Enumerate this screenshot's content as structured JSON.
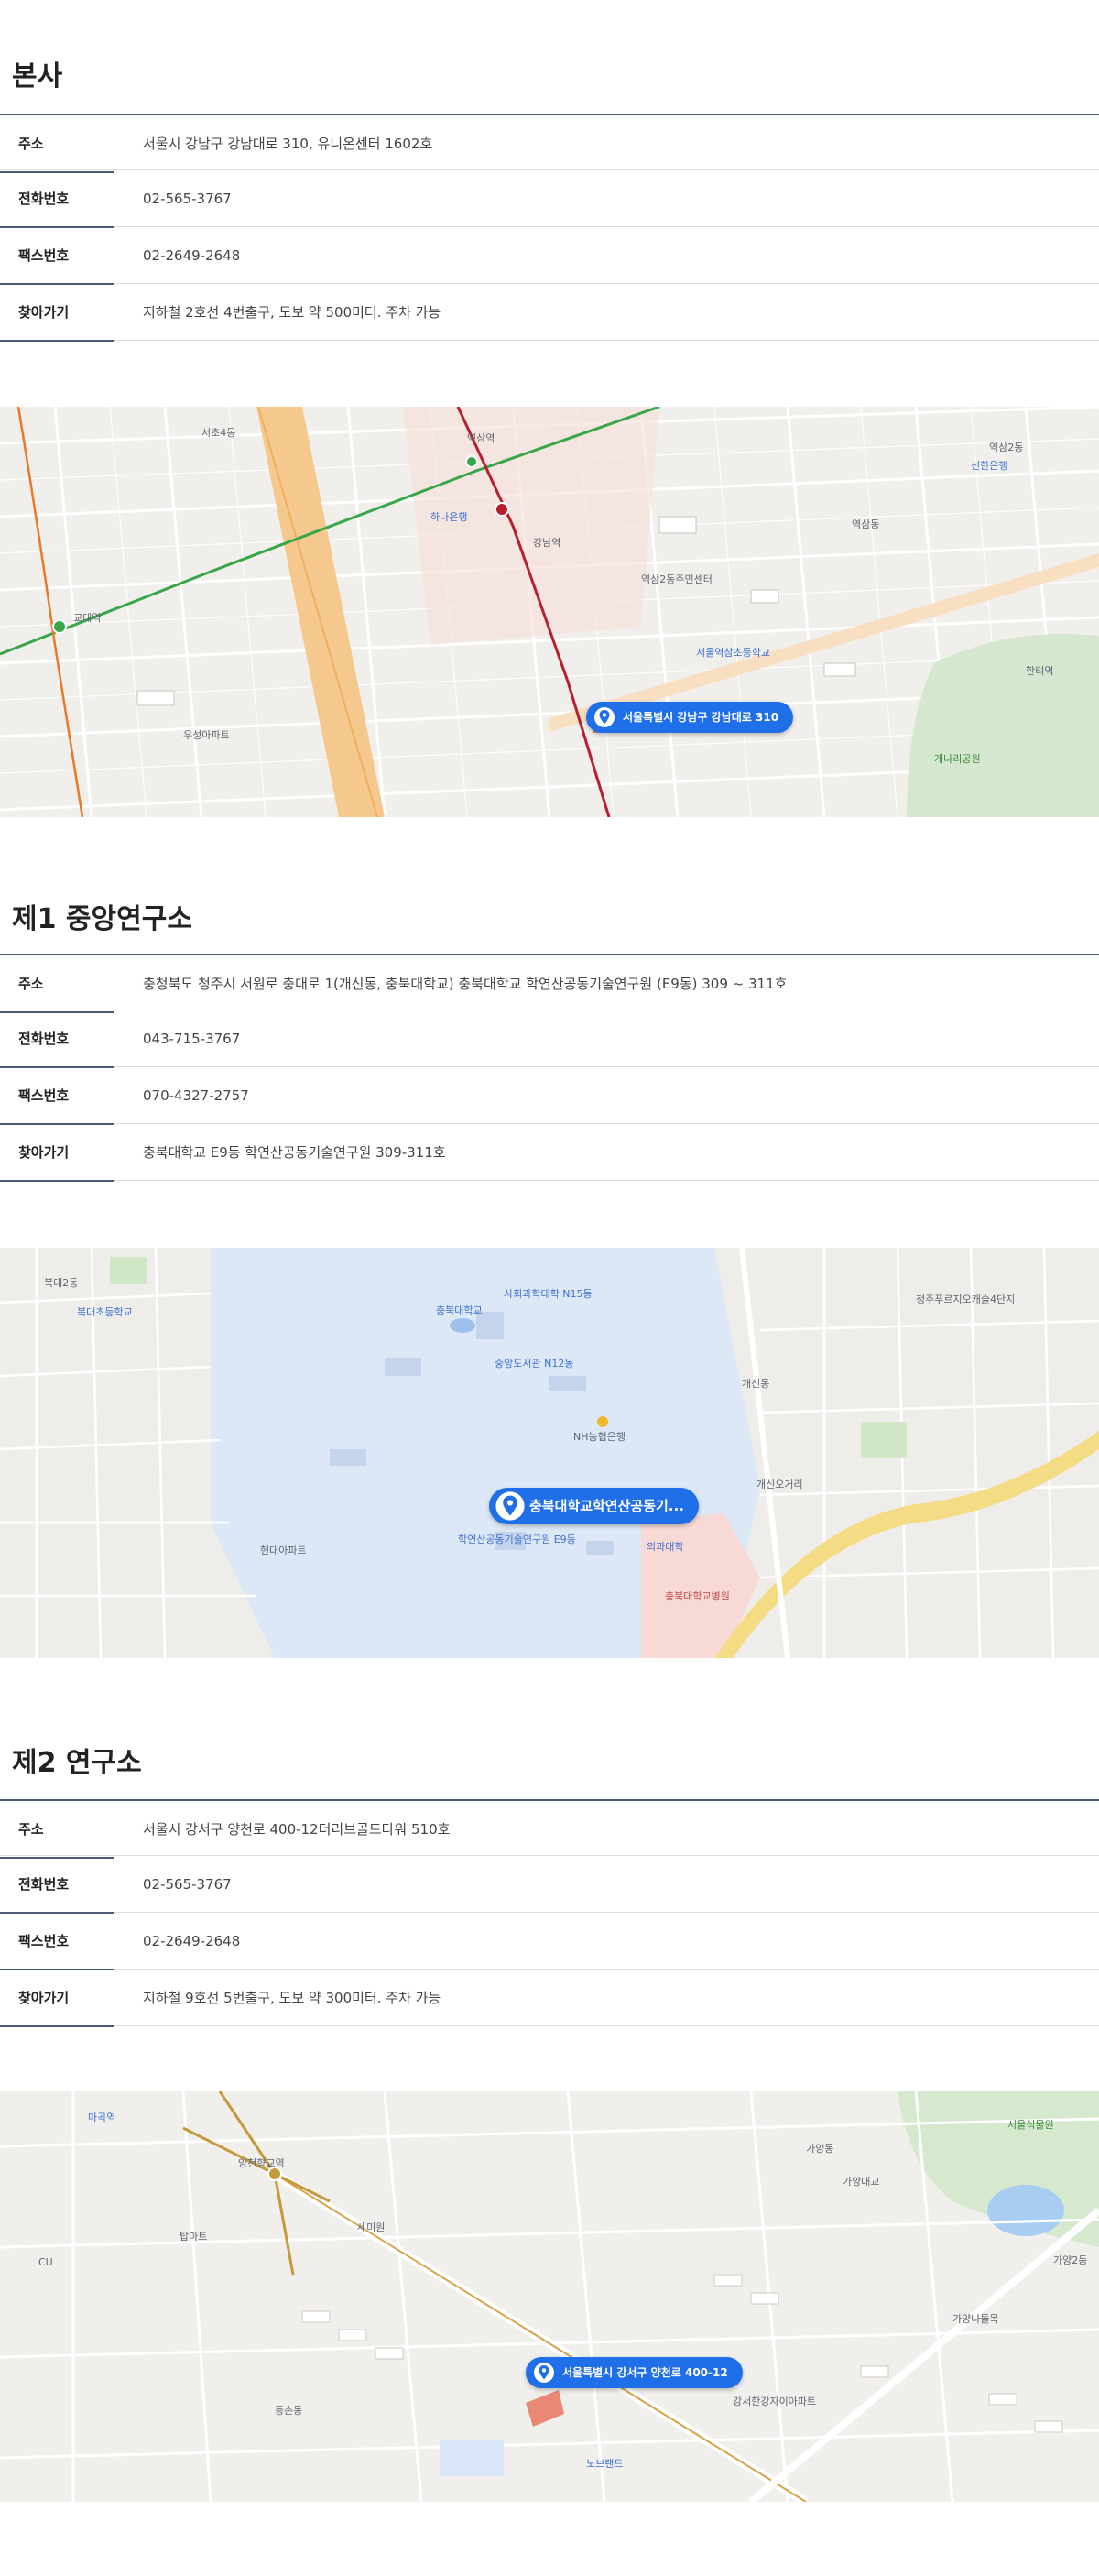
{
  "sections": [
    {
      "title": "본사",
      "rows": [
        {
          "label": "주소",
          "value": "서울시 강남구 강남대로 310, 유니온센터 1602호"
        },
        {
          "label": "전화번호",
          "value": "02-565-3767"
        },
        {
          "label": "팩스번호",
          "value": "02-2649-2648"
        },
        {
          "label": "찾아가기",
          "value": "지하철 2호선 4번출구, 도보 약 500미터. 주차 가능"
        }
      ],
      "map": {
        "marker": "서울특별시 강남구 강남대로 310",
        "labels": [
          "서초4동",
          "역삼2동",
          "역삼2동주민센터",
          "교대역",
          "강남역",
          "역삼역",
          "서울역삼초등학교",
          "역삼동",
          "개나리공원",
          "하나은행",
          "신한은행",
          "한티역",
          "우성아파트"
        ]
      }
    },
    {
      "title": "제1 중앙연구소",
      "rows": [
        {
          "label": "주소",
          "value": "충청북도 청주시 서원로 충대로 1(개신동, 충북대학교) 충북대학교 학연산공동기술연구원 (E9동) 309 ~ 311호"
        },
        {
          "label": "전화번호",
          "value": "043-715-3767"
        },
        {
          "label": "팩스번호",
          "value": "070-4327-2757"
        },
        {
          "label": "찾아가기",
          "value": "충북대학교 E9동 학연산공동기술연구원 309-311호"
        }
      ],
      "map": {
        "marker": "충북대학교학연산공동기...",
        "labels": [
          "복대2동",
          "충북대학교",
          "사회과학대학 N15동",
          "중앙도서관 N12동",
          "NH농협은행",
          "개신동",
          "청주푸르지오캐슬4단지",
          "충북대학교병원",
          "의과대학",
          "개신오거리",
          "복대초등학교",
          "현대아파트",
          "학연산공동기술연구원 E9동"
        ]
      }
    },
    {
      "title": "제2 연구소",
      "rows": [
        {
          "label": "주소",
          "value": "서울시 강서구 양천로 400-12더리브골드타워 510호"
        },
        {
          "label": "전화번호",
          "value": "02-565-3767"
        },
        {
          "label": "팩스번호",
          "value": "02-2649-2648"
        },
        {
          "label": "찾아가기",
          "value": "지하철 9호선 5번출구, 도보 약 300미터. 주차 가능"
        }
      ],
      "map": {
        "marker": "서울특별시 강서구 양천로 400-12",
        "labels": [
          "양천향교역",
          "가양2동",
          "가양동",
          "등촌동",
          "서울식물원",
          "가양나들목",
          "마곡역",
          "강서한강자이아파트",
          "노브랜드",
          "가양대교",
          "세미원",
          "CU",
          "탑마트"
        ]
      }
    }
  ]
}
